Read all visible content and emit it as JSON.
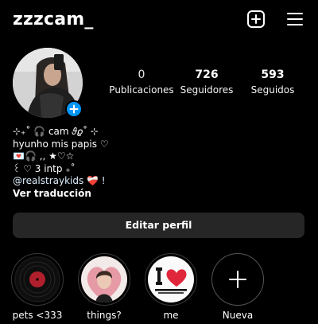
{
  "header": {
    "username": "zzzcam_",
    "add_icon": "plus-square-icon",
    "menu_icon": "hamburger-menu-icon"
  },
  "profile": {
    "stats": [
      {
        "value": "0",
        "label": "Publicaciones"
      },
      {
        "value": "726",
        "label": "Seguidores"
      },
      {
        "value": "593",
        "label": "Seguidos"
      }
    ],
    "bio": [
      "⊹₊˚ 🎧 cam 𝜗𝜚˚ ⊹",
      "hyunho mis papis ♡",
      "💌🎧 ,,  ★♡☆",
      "꒰ ♡ 3  intp ₊˚",
      "@realstraykids ❤️‍🩹 !"
    ],
    "translate": "Ver traducción",
    "edit_button": "Editar perfil"
  },
  "highlights": [
    {
      "label": "pets <333"
    },
    {
      "label": "things?"
    },
    {
      "label": "me"
    },
    {
      "label": "Nueva"
    }
  ],
  "colors": {
    "background": "#000000",
    "button": "#262626",
    "accent": "#0095f6",
    "heart": "#e0263a"
  }
}
